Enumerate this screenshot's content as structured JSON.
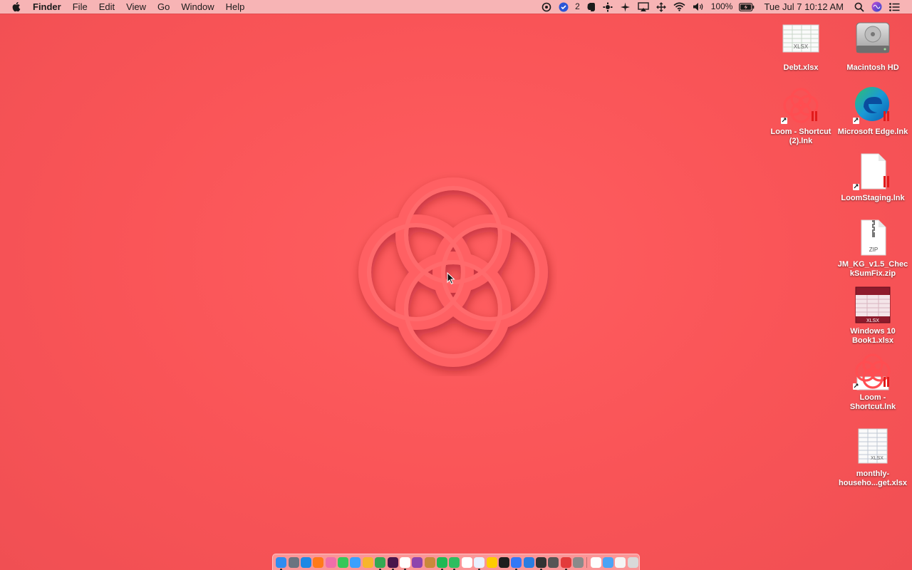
{
  "menubar": {
    "apple_icon": "apple-icon",
    "app_name": "Finder",
    "items": [
      "File",
      "Edit",
      "View",
      "Go",
      "Window",
      "Help"
    ],
    "status": {
      "notification_count": "2",
      "battery": "100%",
      "datetime": "Tue Jul 7  10:12 AM"
    }
  },
  "desktop_icons": [
    {
      "name": "Debt.xlsx",
      "type": "xlsx-icon",
      "badge": "XLSX"
    },
    {
      "name": "Macintosh HD",
      "type": "hard-drive-icon"
    },
    {
      "name": "Loom - Shortcut (2).lnk",
      "type": "loom-icon"
    },
    {
      "name": "Microsoft Edge.lnk",
      "type": "edge-icon"
    },
    {
      "name": "LoomStaging.lnk",
      "type": "document-icon"
    },
    {
      "name": "JM_KG_v1.5_CheckSumFix.zip",
      "type": "zip-icon",
      "badge": "ZIP"
    },
    {
      "name": "Windows 10 Book1.xlsx",
      "type": "xlsx-icon",
      "badge": "XLSX"
    },
    {
      "name": "Loom - Shortcut.lnk",
      "type": "loom-icon"
    },
    {
      "name": "monthly-househo...get.xlsx",
      "type": "xlsx-icon",
      "badge": "XLSX"
    }
  ],
  "dock": {
    "apps": [
      {
        "name": "finder",
        "color": "#2f8cf0",
        "running": true
      },
      {
        "name": "launchpad",
        "color": "#6b7480",
        "running": false
      },
      {
        "name": "safari",
        "color": "#1e88e5",
        "running": false
      },
      {
        "name": "firefox",
        "color": "#ff7a1a",
        "running": false
      },
      {
        "name": "itunes",
        "color": "#f06ea9",
        "running": false
      },
      {
        "name": "messages",
        "color": "#34c759",
        "running": false
      },
      {
        "name": "mail",
        "color": "#3ba0ff",
        "running": false
      },
      {
        "name": "photos",
        "color": "#f7b52c",
        "running": false
      },
      {
        "name": "chrome",
        "color": "#34a853",
        "running": true
      },
      {
        "name": "slack",
        "color": "#4a154b",
        "running": true
      },
      {
        "name": "notion",
        "color": "#ffffff",
        "running": true
      },
      {
        "name": "podcast",
        "color": "#8e44ad",
        "running": false
      },
      {
        "name": "squirrel",
        "color": "#c9893a",
        "running": false
      },
      {
        "name": "spotify",
        "color": "#1db954",
        "running": true
      },
      {
        "name": "evernote",
        "color": "#2dbe60",
        "running": true
      },
      {
        "name": "calendar",
        "color": "#ffffff",
        "running": false
      },
      {
        "name": "todo",
        "color": "#e8f0ff",
        "running": true
      },
      {
        "name": "tips",
        "color": "#ffcc00",
        "running": false
      },
      {
        "name": "terminal",
        "color": "#1e1e1e",
        "running": false
      },
      {
        "name": "monitor",
        "color": "#3478f6",
        "running": true
      },
      {
        "name": "windows",
        "color": "#2a7de1",
        "running": false
      },
      {
        "name": "activity",
        "color": "#333333",
        "running": true
      },
      {
        "name": "screenshot",
        "color": "#555555",
        "running": false
      },
      {
        "name": "loom-dock",
        "color": "#e33b3b",
        "running": true
      },
      {
        "name": "system-prefs",
        "color": "#8a8a8a",
        "running": false
      }
    ],
    "trailing": [
      {
        "name": "documents-folder",
        "color": "#fdfdfd"
      },
      {
        "name": "downloads-folder",
        "color": "#4aa3f5"
      },
      {
        "name": "files-stack",
        "color": "#f5f5f5"
      },
      {
        "name": "trash",
        "color": "#d9d9d9"
      }
    ]
  }
}
